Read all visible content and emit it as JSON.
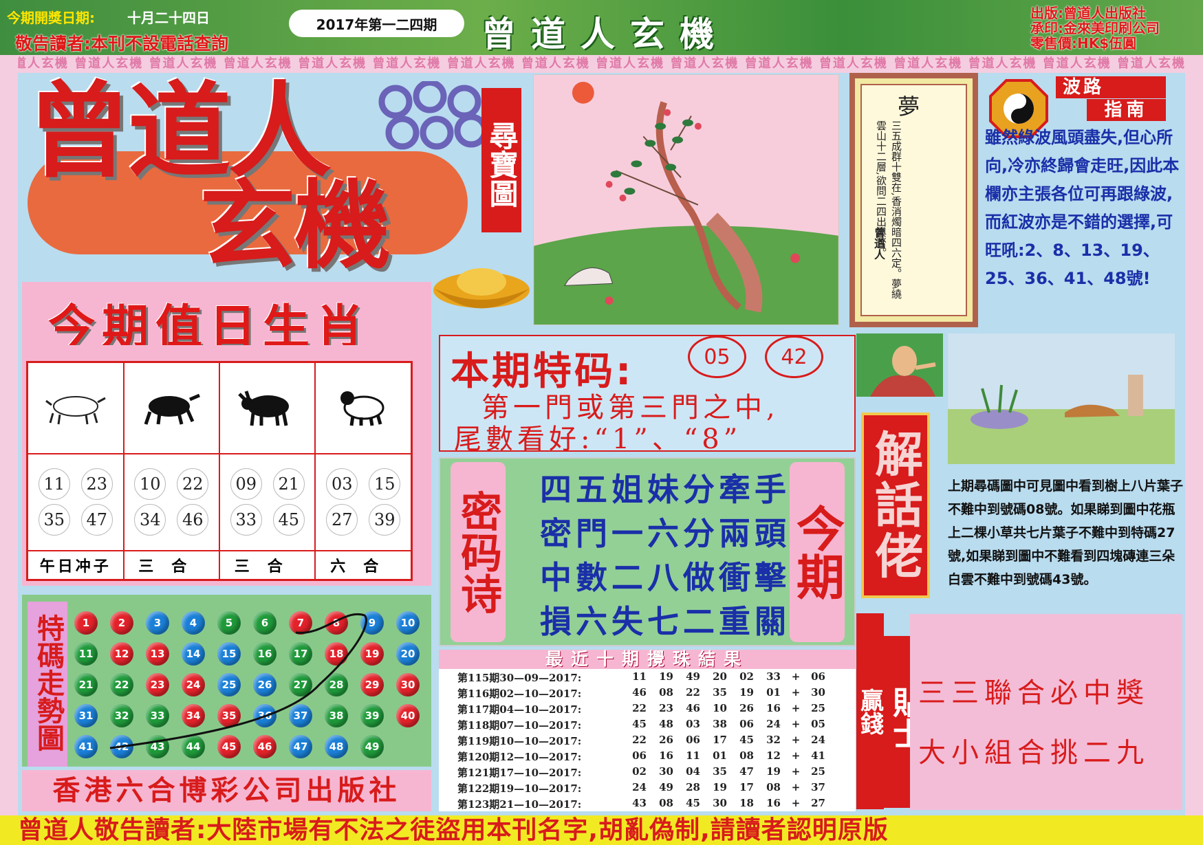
{
  "header": {
    "open_date_label": "今期開獎日期:",
    "open_date": "十月二十四日",
    "notice": "敬告讀者:本刊不設電話查詢",
    "issue": "2017年第一二四期",
    "brand": "曾道人玄機",
    "publisher_lines": [
      "出版:曾道人出版社",
      "承印:金來美印刷公司",
      "零售價:HK$伍圓"
    ]
  },
  "frame": {
    "pattern_text": "曾道人玄機"
  },
  "title": {
    "line1": "曾道人",
    "line2": "玄機",
    "treasure_label": "尋寶圖"
  },
  "zodiac": {
    "title": "今期值日生肖",
    "columns": [
      {
        "icon": "rat-icon",
        "numbers": [
          "11",
          "23",
          "35",
          "47"
        ],
        "label": "午日冲子"
      },
      {
        "icon": "ox-icon",
        "numbers": [
          "10",
          "22",
          "34",
          "46"
        ],
        "label": "三合"
      },
      {
        "icon": "ox-icon",
        "numbers": [
          "09",
          "21",
          "33",
          "45"
        ],
        "label": "三合"
      },
      {
        "icon": "goat-icon",
        "numbers": [
          "03",
          "15",
          "27",
          "39"
        ],
        "label": "六合"
      }
    ]
  },
  "trend": {
    "label": "特碼走勢圖",
    "balls": [
      {
        "n": "1",
        "c": "#e3222a"
      },
      {
        "n": "2",
        "c": "#e3222a"
      },
      {
        "n": "3",
        "c": "#1a80d8"
      },
      {
        "n": "4",
        "c": "#1a80d8"
      },
      {
        "n": "5",
        "c": "#1f9a3a"
      },
      {
        "n": "6",
        "c": "#1f9a3a"
      },
      {
        "n": "7",
        "c": "#e3222a"
      },
      {
        "n": "8",
        "c": "#e3222a"
      },
      {
        "n": "9",
        "c": "#1a80d8"
      },
      {
        "n": "10",
        "c": "#1a80d8"
      },
      {
        "n": "11",
        "c": "#1f9a3a"
      },
      {
        "n": "12",
        "c": "#e3222a"
      },
      {
        "n": "13",
        "c": "#e3222a"
      },
      {
        "n": "14",
        "c": "#1a80d8"
      },
      {
        "n": "15",
        "c": "#1a80d8"
      },
      {
        "n": "16",
        "c": "#1f9a3a"
      },
      {
        "n": "17",
        "c": "#1f9a3a"
      },
      {
        "n": "18",
        "c": "#e3222a"
      },
      {
        "n": "19",
        "c": "#e3222a"
      },
      {
        "n": "20",
        "c": "#1a80d8"
      },
      {
        "n": "21",
        "c": "#1f9a3a"
      },
      {
        "n": "22",
        "c": "#1f9a3a"
      },
      {
        "n": "23",
        "c": "#e3222a"
      },
      {
        "n": "24",
        "c": "#e3222a"
      },
      {
        "n": "25",
        "c": "#1a80d8"
      },
      {
        "n": "26",
        "c": "#1a80d8"
      },
      {
        "n": "27",
        "c": "#1f9a3a"
      },
      {
        "n": "28",
        "c": "#1f9a3a"
      },
      {
        "n": "29",
        "c": "#e3222a"
      },
      {
        "n": "30",
        "c": "#e3222a"
      },
      {
        "n": "31",
        "c": "#1a80d8"
      },
      {
        "n": "32",
        "c": "#1f9a3a"
      },
      {
        "n": "33",
        "c": "#1f9a3a"
      },
      {
        "n": "34",
        "c": "#e3222a"
      },
      {
        "n": "35",
        "c": "#e3222a"
      },
      {
        "n": "36",
        "c": "#1a80d8"
      },
      {
        "n": "37",
        "c": "#1a80d8"
      },
      {
        "n": "38",
        "c": "#1f9a3a"
      },
      {
        "n": "39",
        "c": "#1f9a3a"
      },
      {
        "n": "40",
        "c": "#e3222a"
      },
      {
        "n": "41",
        "c": "#1a80d8"
      },
      {
        "n": "42",
        "c": "#1a80d8"
      },
      {
        "n": "43",
        "c": "#1f9a3a"
      },
      {
        "n": "44",
        "c": "#1f9a3a"
      },
      {
        "n": "45",
        "c": "#e3222a"
      },
      {
        "n": "46",
        "c": "#e3222a"
      },
      {
        "n": "47",
        "c": "#1a80d8"
      },
      {
        "n": "48",
        "c": "#1a80d8"
      },
      {
        "n": "49",
        "c": "#1f9a3a"
      }
    ]
  },
  "publisher_banner": "香港六合博彩公司出版社",
  "special": {
    "title": "本期特码:",
    "codes": [
      "05",
      "42"
    ],
    "line1": "第一門或第三門之中,",
    "line2": "尾數看好:“1”、“8”"
  },
  "poem": {
    "label": "密码诗",
    "label_right": "今期",
    "lines": [
      "四五姐妹分牽手",
      "密門一六分兩頭",
      "中數二八做衝擊",
      "損六失七二重關"
    ]
  },
  "results": {
    "title": "最近十期攪珠結果",
    "rows": [
      {
        "period": "第115期30—09—2017:",
        "nums": [
          "11",
          "19",
          "49",
          "20",
          "02",
          "33"
        ],
        "special": "06"
      },
      {
        "period": "第116期02—10—2017:",
        "nums": [
          "46",
          "08",
          "22",
          "35",
          "19",
          "01"
        ],
        "special": "30"
      },
      {
        "period": "第117期04—10—2017:",
        "nums": [
          "22",
          "23",
          "46",
          "10",
          "26",
          "16"
        ],
        "special": "25"
      },
      {
        "period": "第118期07—10—2017:",
        "nums": [
          "45",
          "48",
          "03",
          "38",
          "06",
          "24"
        ],
        "special": "05"
      },
      {
        "period": "第119期10—10—2017:",
        "nums": [
          "22",
          "26",
          "06",
          "17",
          "45",
          "32"
        ],
        "special": "24"
      },
      {
        "period": "第120期12—10—2017:",
        "nums": [
          "06",
          "16",
          "11",
          "01",
          "08",
          "12"
        ],
        "special": "41"
      },
      {
        "period": "第121期17—10—2017:",
        "nums": [
          "02",
          "30",
          "04",
          "35",
          "47",
          "19"
        ],
        "special": "25"
      },
      {
        "period": "第122期19—10—2017:",
        "nums": [
          "24",
          "49",
          "28",
          "19",
          "17",
          "08"
        ],
        "special": "37"
      },
      {
        "period": "第123期21—10—2017:",
        "nums": [
          "43",
          "08",
          "45",
          "30",
          "18",
          "16"
        ],
        "special": "27"
      }
    ]
  },
  "dream": {
    "title": "夢",
    "text": "三五成群十雙在,香消燭暗四六定。夢繞雲山十二層,欲問二四出與否。",
    "signature": "曾道人"
  },
  "guide": {
    "label1": "波路",
    "label2": "指南",
    "text": "雖然綠波風頭盡失,但心所向,冷亦終歸會走旺,因此本欄亦主張各位可再跟綠波,而紅波亦是不錯的選擇,可旺吼:2、8、13、19、25、36、41、48號!"
  },
  "explain": {
    "label": "解話佬",
    "text": "上期尋碼圖中可見圖中看到樹上八片葉子不難中到號碼08號。如果睇到圖中花瓶上二棵小草共七片葉子不難中到特碼27號,如果睇到圖中不難看到四塊磚連三朵白雲不難中到號碼43號。"
  },
  "tips": {
    "label_win": "贏錢",
    "label_tip": "貼士",
    "line1": "三三聯合必中獎",
    "line2": "大小組合挑二九"
  },
  "footer": "曾道人敬告讀者:大陸市場有不法之徒盜用本刊名字,胡亂偽制,請讀者認明原版"
}
